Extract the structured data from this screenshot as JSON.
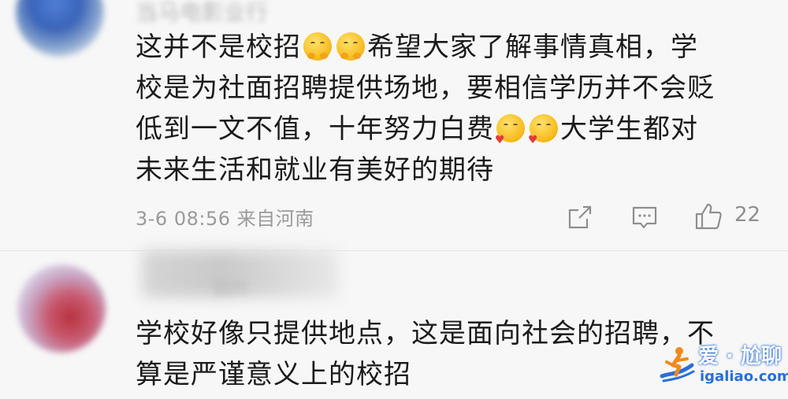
{
  "comments": [
    {
      "author": "当马电影业行",
      "lines": [
        {
          "before": "这并不是校招",
          "emoji": [
            "hug-emoji",
            "hug-emoji"
          ],
          "after": "希望大家了解事情真相，学"
        },
        {
          "text": "校是为社面招聘提供场地，要相信学历并不会贬"
        },
        {
          "before": "低到一文不值，十年努力白费",
          "emoji": [
            "love-emoji",
            "love-emoji"
          ],
          "after": "大学生都对"
        },
        {
          "text": "未来生活和就业有美好的期待"
        }
      ],
      "timestamp": "3-6 08:56",
      "location": "来自河南",
      "like_count": "22"
    },
    {
      "author": "我的",
      "lines": [
        {
          "text": "学校好像只提供地点，这是面向社会的招聘，不"
        },
        {
          "text": "算是严谨意义上的校招"
        }
      ]
    }
  ],
  "watermark": {
    "title": "爱 · 尬聊",
    "url": "igaliao.com"
  },
  "colors": {
    "background": "#f7f7f7",
    "text": "#1b1b1b",
    "meta": "#9a9a9a",
    "watermark": "#2a6fd6"
  }
}
